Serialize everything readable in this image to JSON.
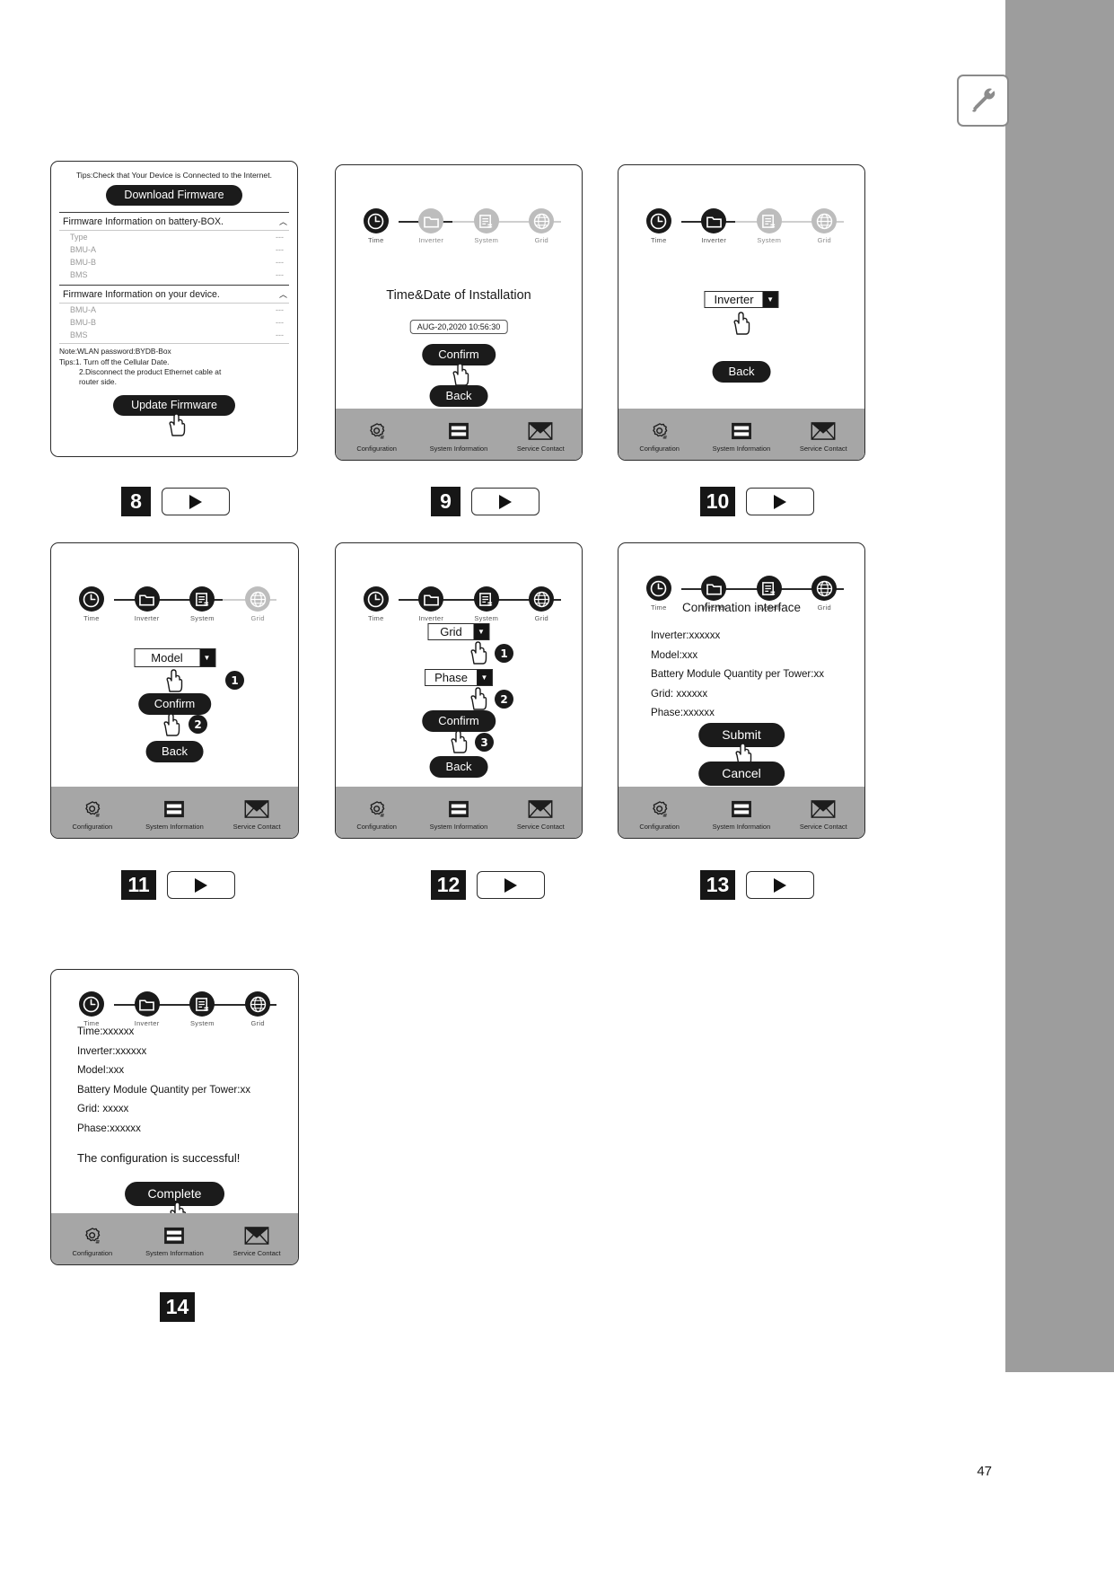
{
  "page": {
    "number": "47",
    "tool_icon": "tools-icon"
  },
  "nav": {
    "items": [
      {
        "label": "Configuration",
        "icon": "gear-icon"
      },
      {
        "label": "System Information",
        "icon": "list-icon"
      },
      {
        "label": "Service Contact",
        "icon": "envelope-icon"
      }
    ]
  },
  "wizard_steps": [
    {
      "label": "Time",
      "icon": "clock-icon"
    },
    {
      "label": "Inverter",
      "icon": "folder-icon"
    },
    {
      "label": "System",
      "icon": "system-transfer-icon"
    },
    {
      "label": "Grid",
      "icon": "globe-icon"
    }
  ],
  "panels": [
    {
      "step": "8",
      "type": "firmware",
      "tips_header": "Tips:Check that Your Device is Connected to the Internet.",
      "download_button": "Download Firmware",
      "section_battery_box": "Firmware Information on battery-BOX.",
      "battery_rows": [
        {
          "label": "Type",
          "value": "---"
        },
        {
          "label": "BMU-A",
          "value": "---"
        },
        {
          "label": "BMU-B",
          "value": "---"
        },
        {
          "label": "BMS",
          "value": "---"
        }
      ],
      "section_device": "Firmware Information on your device.",
      "device_rows": [
        {
          "label": "BMU-A",
          "value": "---"
        },
        {
          "label": "BMU-B",
          "value": "---"
        },
        {
          "label": "BMS",
          "value": "---"
        }
      ],
      "note1": "Note:WLAN password:BYDB-Box",
      "note2": "Tips:1. Turn off the Cellular Date.",
      "note3": "2.Disconnect the product Ethernet cable at",
      "note4": "router side.",
      "update_button": "Update Firmware"
    },
    {
      "step": "9",
      "type": "time",
      "active_step": 0,
      "title": "Time&Date of Installation",
      "date_value": "AUG-20,2020 10:56:30",
      "confirm_button": "Confirm",
      "back_button": "Back"
    },
    {
      "step": "10",
      "type": "inverter",
      "active_step": 1,
      "dropdown_value": "Inverter",
      "back_button": "Back"
    },
    {
      "step": "11",
      "type": "model",
      "active_step": 2,
      "dropdown_value": "Model",
      "confirm_button": "Confirm",
      "back_button": "Back",
      "markers": [
        "1",
        "2"
      ]
    },
    {
      "step": "12",
      "type": "grid",
      "active_step": 3,
      "dropdown_grid": "Grid",
      "dropdown_phase": "Phase",
      "confirm_button": "Confirm",
      "back_button": "Back",
      "markers": [
        "1",
        "2",
        "3"
      ]
    },
    {
      "step": "13",
      "type": "confirmation",
      "active_step": 3,
      "title": "Confirmation interface",
      "lines": [
        "Inverter:xxxxxx",
        "Model:xxx",
        "Battery Module Quantity per Tower:xx",
        "Grid: xxxxxx",
        "Phase:xxxxxx"
      ],
      "submit_button": "Submit",
      "cancel_button": "Cancel"
    },
    {
      "step": "14",
      "type": "success",
      "active_step": 3,
      "lines": [
        "Time:xxxxxx",
        "Inverter:xxxxxx",
        "Model:xxx",
        "Battery Module Quantity per Tower:xx",
        "Grid: xxxxx",
        "Phase:xxxxxx"
      ],
      "success_message": "The configuration is successful!",
      "complete_button": "Complete"
    }
  ]
}
